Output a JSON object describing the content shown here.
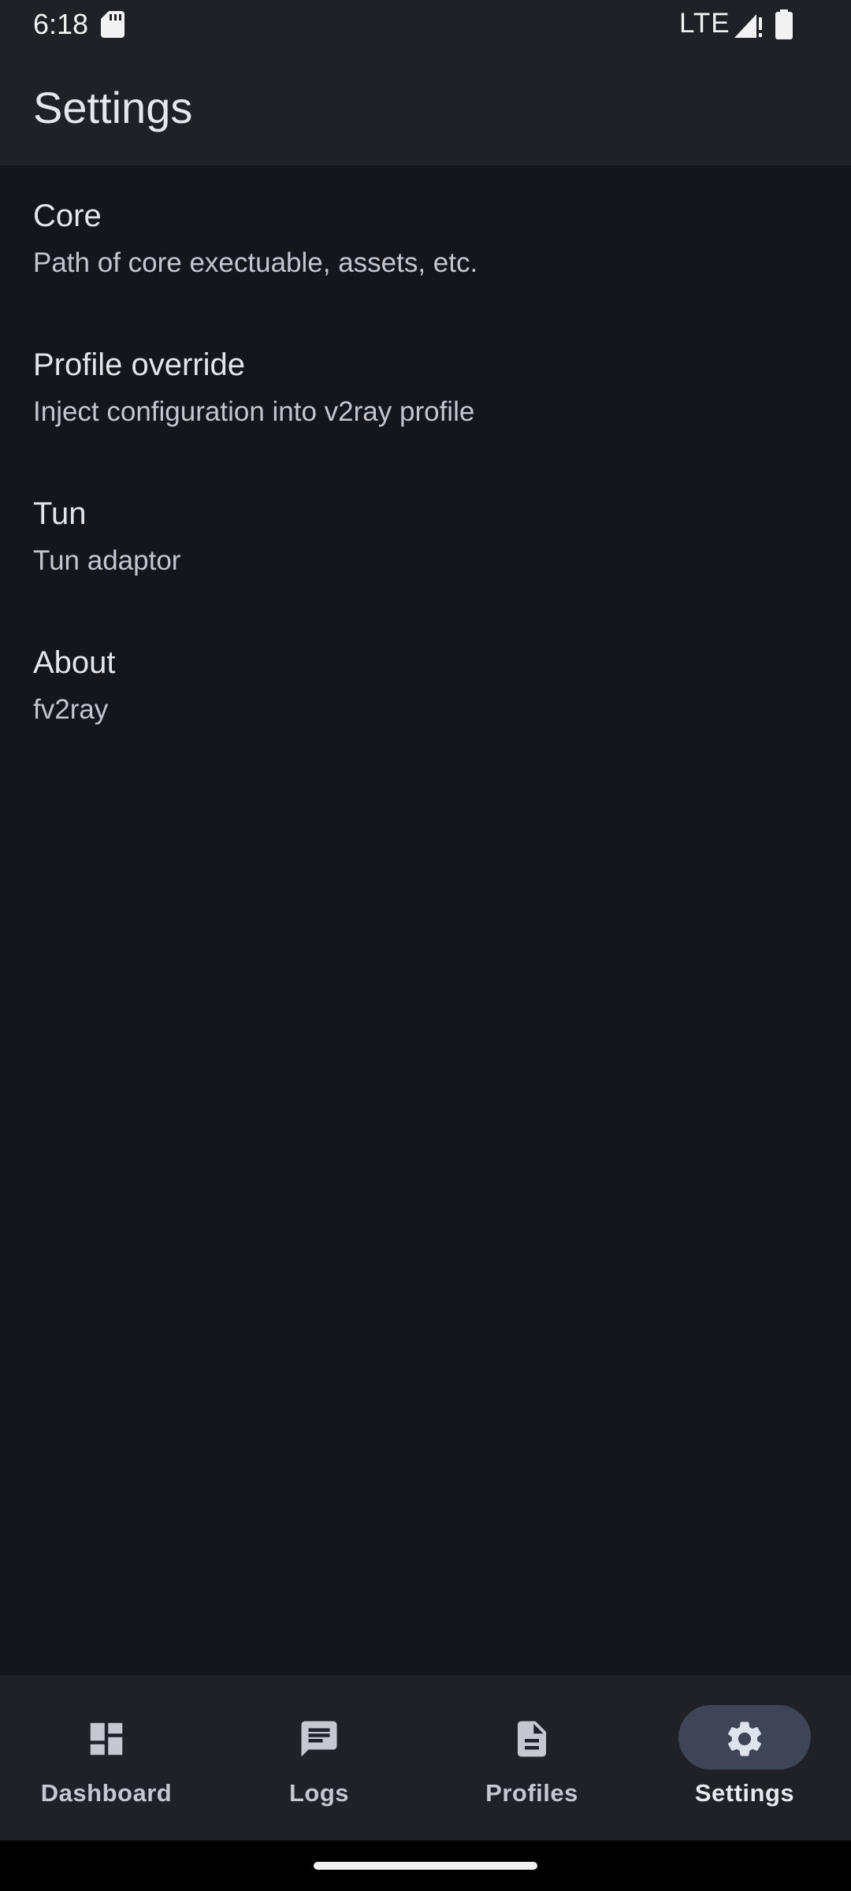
{
  "status_bar": {
    "time": "6:18",
    "network": "LTE",
    "icons": [
      "sd-card-icon",
      "signal-icon",
      "battery-icon"
    ]
  },
  "app_bar": {
    "title": "Settings"
  },
  "settings": [
    {
      "title": "Core",
      "subtitle": "Path of core exectuable, assets, etc."
    },
    {
      "title": "Profile override",
      "subtitle": "Inject configuration into v2ray profile"
    },
    {
      "title": "Tun",
      "subtitle": "Tun adaptor"
    },
    {
      "title": "About",
      "subtitle": "fv2ray"
    }
  ],
  "bottom_nav": {
    "items": [
      {
        "label": "Dashboard",
        "icon": "dashboard-icon",
        "active": false
      },
      {
        "label": "Logs",
        "icon": "chat-message-icon",
        "active": false
      },
      {
        "label": "Profiles",
        "icon": "document-icon",
        "active": false
      },
      {
        "label": "Settings",
        "icon": "gear-icon",
        "active": true
      }
    ]
  },
  "colors": {
    "background": "#15161b",
    "surface": "#1f2126",
    "active_indicator": "#3d4556",
    "text_primary": "#e4e5ea",
    "text_secondary": "#c4c6cf"
  }
}
